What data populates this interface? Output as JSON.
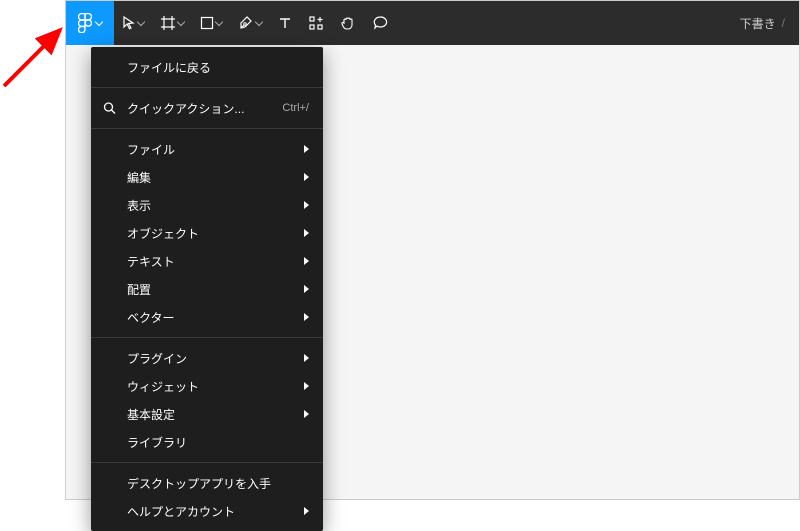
{
  "title": "下書き",
  "menu": {
    "back": "ファイルに戻る",
    "quick": "クイックアクション...",
    "quick_shortcut": "Ctrl+/",
    "group1": [
      {
        "label": "ファイル",
        "sub": true
      },
      {
        "label": "編集",
        "sub": true
      },
      {
        "label": "表示",
        "sub": true
      },
      {
        "label": "オブジェクト",
        "sub": true
      },
      {
        "label": "テキスト",
        "sub": true
      },
      {
        "label": "配置",
        "sub": true
      },
      {
        "label": "ベクター",
        "sub": true
      }
    ],
    "group2": [
      {
        "label": "プラグイン",
        "sub": true
      },
      {
        "label": "ウィジェット",
        "sub": true
      },
      {
        "label": "基本設定",
        "sub": true
      },
      {
        "label": "ライブラリ",
        "sub": false
      }
    ],
    "group3": [
      {
        "label": "デスクトップアプリを入手",
        "sub": false
      },
      {
        "label": "ヘルプとアカウント",
        "sub": true
      }
    ]
  }
}
